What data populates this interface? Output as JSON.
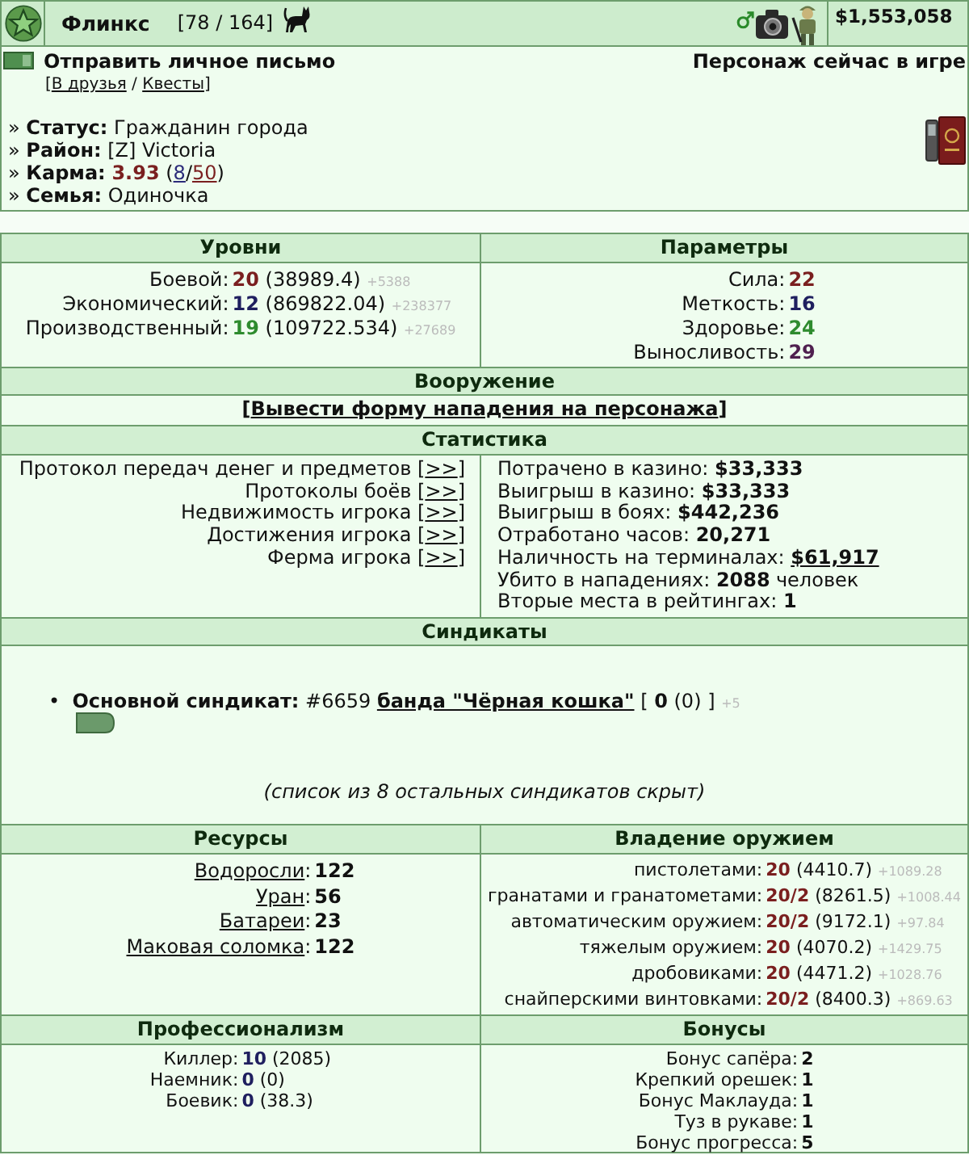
{
  "header": {
    "name": "Флинкс",
    "rank": "[78 / 164]",
    "money": "$1,553,058"
  },
  "contact": {
    "send_message": "Отправить личное письмо",
    "links": {
      "open": "[",
      "separator": " / ",
      "close": "]",
      "items": [
        {
          "text": "В друзья"
        },
        {
          "text": "Квесты"
        }
      ]
    },
    "presence": "Персонаж сейчас в игре"
  },
  "profile": {
    "bullet": "»",
    "items": [
      {
        "kind": "text",
        "label": "Статус:",
        "value": "Гражданин города"
      },
      {
        "kind": "text",
        "label": "Район:",
        "value": "[Z] Victoria"
      },
      {
        "kind": "karma",
        "label": "Карма:",
        "value": "3.93",
        "votes": {
          "open": "(",
          "separator": "/",
          "close": ")",
          "items": [
            {
              "text": "8",
              "color": "#2b2b7a"
            },
            {
              "text": "50",
              "color": "#7a1f1f"
            }
          ]
        }
      },
      {
        "kind": "text",
        "label": "Семья:",
        "value": "Одиночка"
      }
    ]
  },
  "levels": {
    "title": "Уровни",
    "items": [
      {
        "label": "Боевой:",
        "value": "20",
        "color": "#7a1f1f",
        "experience": "(38989.4)",
        "gain": "+5388"
      },
      {
        "label": "Экономический:",
        "value": "12",
        "color": "#1f1f5f",
        "experience": "(869822.04)",
        "gain": "+238377"
      },
      {
        "label": "Производственный:",
        "value": "19",
        "color": "#2e8b2e",
        "experience": "(109722.534)",
        "gain": "+27689"
      }
    ]
  },
  "parameters": {
    "title": "Параметры",
    "items": [
      {
        "label": "Сила:",
        "value": "22",
        "color": "#7a1f1f"
      },
      {
        "label": "Меткость:",
        "value": "16",
        "color": "#1f1f5f"
      },
      {
        "label": "Здоровье:",
        "value": "24",
        "color": "#2e8b2e"
      },
      {
        "label": "Выносливость:",
        "value": "29",
        "color": "#4f1f4f"
      }
    ]
  },
  "armament": {
    "title": "Вооружение",
    "action": {
      "open": "[",
      "link": "Вывести форму нападения на персонажа",
      "close": "]"
    }
  },
  "statistics": {
    "title": "Статистика",
    "links": [
      {
        "label": "Протокол передач денег и предметов",
        "open": "[",
        "link": ">>",
        "close": "]"
      },
      {
        "label": "Протоколы боёв",
        "open": "[",
        "link": ">>",
        "close": "]"
      },
      {
        "label": "Недвижимость игрока",
        "open": "[",
        "link": ">>",
        "close": "]"
      },
      {
        "label": "Достижения игрока",
        "open": "[",
        "link": ">>",
        "close": "]"
      },
      {
        "label": "Ферма игрока",
        "open": "[",
        "link": ">>",
        "close": "]"
      }
    ],
    "figures": [
      {
        "kind": "value",
        "label": "Потрачено в казино:",
        "value": "$33,333"
      },
      {
        "kind": "value",
        "label": "Выигрыш в казино:",
        "value": "$33,333"
      },
      {
        "kind": "value",
        "label": "Выигрыш в боях:",
        "value": "$442,236"
      },
      {
        "kind": "value",
        "label": "Отработано часов:",
        "value": "20,271"
      },
      {
        "kind": "link",
        "label": "Наличность на терминалах:",
        "value": "$61,917"
      },
      {
        "kind": "value",
        "label": "Убито в нападениях:",
        "value": "2088",
        "suffix": "человек"
      },
      {
        "kind": "value",
        "label": "Вторые места в рейтингах:",
        "value": "1"
      }
    ]
  },
  "syndicates": {
    "title": "Синдикаты",
    "main": {
      "bullet": "•",
      "label": "Основной синдикат:",
      "number": "#6659",
      "name": "банда \"Чёрная кошка\"",
      "score": "[ **0** (0) ]",
      "gain": "+5"
    },
    "note": "(список из 8 остальных синдикатов скрыт)"
  },
  "resources": {
    "title": "Ресурсы",
    "items": [
      {
        "name": "Водоросли",
        "separator": ":",
        "value": "122"
      },
      {
        "name": "Уран",
        "separator": ":",
        "value": "56"
      },
      {
        "name": "Батареи",
        "separator": ":",
        "value": "23"
      },
      {
        "name": "Маковая соломка",
        "separator": ":",
        "value": "122"
      }
    ]
  },
  "weapons": {
    "title": "Владение оружием",
    "items": [
      {
        "label": "пистолетами:",
        "value": "20",
        "experience": "(4410.7)",
        "gain": "+1089.28"
      },
      {
        "label": "гранатами и гранатометами:",
        "value": "20/2",
        "experience": "(8261.5)",
        "gain": "+1008.44"
      },
      {
        "label": "автоматическим оружием:",
        "value": "20/2",
        "experience": "(9172.1)",
        "gain": "+97.84"
      },
      {
        "label": "тяжелым оружием:",
        "value": "20",
        "experience": "(4070.2)",
        "gain": "+1429.75"
      },
      {
        "label": "дробовиками:",
        "value": "20",
        "experience": "(4471.2)",
        "gain": "+1028.76"
      },
      {
        "label": "снайперскими винтовками:",
        "value": "20/2",
        "experience": "(8400.3)",
        "gain": "+869.63"
      }
    ]
  },
  "professions": {
    "title": "Профессионализм",
    "items": [
      {
        "label": "Киллер:",
        "value": "10",
        "experience": "(2085)"
      },
      {
        "label": "Наемник:",
        "value": "0",
        "experience": "(0)"
      },
      {
        "label": "Боевик:",
        "value": "0",
        "experience": "(38.3)"
      }
    ]
  },
  "bonuses": {
    "title": "Бонусы",
    "items": [
      {
        "label": "Бонус сапёра:",
        "value": "2"
      },
      {
        "label": "Крепкий орешек:",
        "value": "1"
      },
      {
        "label": "Бонус Маклауда:",
        "value": "1"
      },
      {
        "label": "Туз в рукаве:",
        "value": "1"
      },
      {
        "label": "Бонус прогресса:",
        "value": "5"
      }
    ]
  }
}
